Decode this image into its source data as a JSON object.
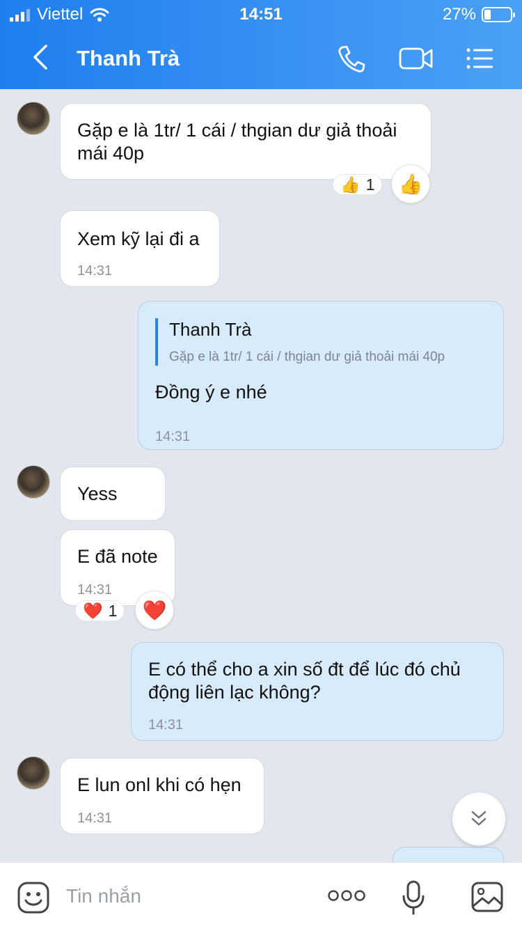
{
  "status_bar": {
    "carrier": "Viettel",
    "time": "14:51",
    "battery": "27%"
  },
  "header": {
    "title": "Thanh Trà",
    "icons": [
      "back-icon",
      "phone-icon",
      "video-call-icon",
      "menu-list-icon"
    ]
  },
  "messages": [
    {
      "dir": "in",
      "text_line1": "Gặp e là 1tr/ 1 cái / thgian dư giả thoải",
      "text_line2": "mái 40p",
      "reaction": {
        "emoji": "👍",
        "count": "1"
      }
    },
    {
      "dir": "in",
      "text": "Xem kỹ lại đi a",
      "time": "14:31"
    },
    {
      "dir": "out",
      "quote_name": "Thanh Trà",
      "quote_text": "Gặp e là 1tr/ 1 cái / thgian dư giả thoải mái 40p",
      "text": "Đồng ý e nhé",
      "time": "14:31"
    },
    {
      "dir": "in",
      "text": "Yess"
    },
    {
      "dir": "in",
      "text": "E đã note",
      "time": "14:31",
      "reaction": {
        "emoji": "❤️",
        "count": "1"
      }
    },
    {
      "dir": "out",
      "text_line1": "E có thể cho a xin số đt để lúc đó chủ",
      "text_line2": "động liên lạc không?",
      "time": "14:31"
    },
    {
      "dir": "in",
      "text": "E lun onl khi có hẹn",
      "time": "14:31"
    }
  ],
  "composer": {
    "placeholder": "Tin nhắn",
    "more_label": "ooo",
    "icons": [
      "sticker-icon",
      "more-icon",
      "microphone-icon",
      "image-icon"
    ]
  },
  "colors": {
    "header": "#1f7ff0",
    "incoming": "#ffffff",
    "outgoing": "#d7ebfb",
    "background": "#e2e6ee",
    "quote_bar": "#2f7fe6"
  }
}
